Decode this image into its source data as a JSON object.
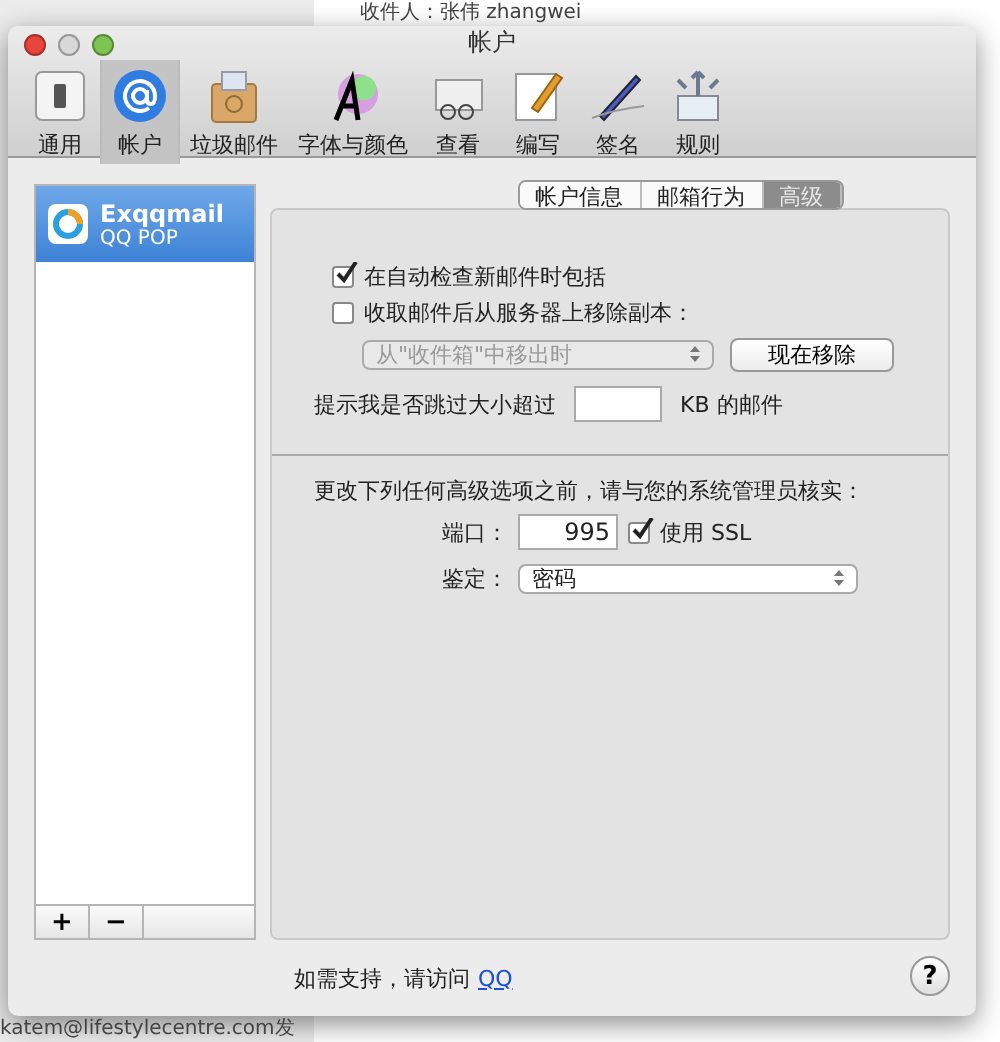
{
  "background": {
    "texts": [
      "收件人：张伟 zhangwei",
      "katem@lifestylecentre.com发"
    ]
  },
  "window": {
    "title": "帐户"
  },
  "toolbar": [
    {
      "label": "通用",
      "selected": false,
      "kind": "switch"
    },
    {
      "label": "帐户",
      "selected": true,
      "kind": "at"
    },
    {
      "label": "垃圾邮件",
      "selected": false,
      "kind": "junk"
    },
    {
      "label": "字体与颜色",
      "selected": false,
      "kind": "font"
    },
    {
      "label": "查看",
      "selected": false,
      "kind": "view"
    },
    {
      "label": "编写",
      "selected": false,
      "kind": "compose"
    },
    {
      "label": "签名",
      "selected": false,
      "kind": "signature"
    },
    {
      "label": "规则",
      "selected": false,
      "kind": "rules"
    }
  ],
  "accounts": [
    {
      "name": "Exqqmail",
      "type": "QQ POP",
      "selected": true
    }
  ],
  "list_buttons": [
    "+",
    "−"
  ],
  "tabs": [
    {
      "label": "帐户信息",
      "selected": false
    },
    {
      "label": "邮箱行为",
      "selected": false
    },
    {
      "label": "高级",
      "selected": true
    }
  ],
  "options": [
    {
      "label": "在自动检查新邮件时包括",
      "checked": true
    },
    {
      "label": "收取邮件后从服务器上移除副本：",
      "checked": false
    }
  ],
  "remove_select": {
    "value": "从\"收件箱\"中移出时",
    "disabled": true
  },
  "remove_now_button": "现在移除",
  "size_prompt": {
    "before": "提示我是否跳过大小超过",
    "after": "KB 的邮件"
  },
  "warning": "更改下列任何高级选项之前，请与您的系统管理员核实：",
  "port": {
    "label": "端口：",
    "value": "995"
  },
  "ssl": {
    "label": "使用 SSL",
    "checked": true
  },
  "auth": {
    "label": "鉴定：",
    "value": "密码"
  },
  "footer": {
    "text": "如需支持，请访问",
    "link": "QQ"
  },
  "help": "?"
}
